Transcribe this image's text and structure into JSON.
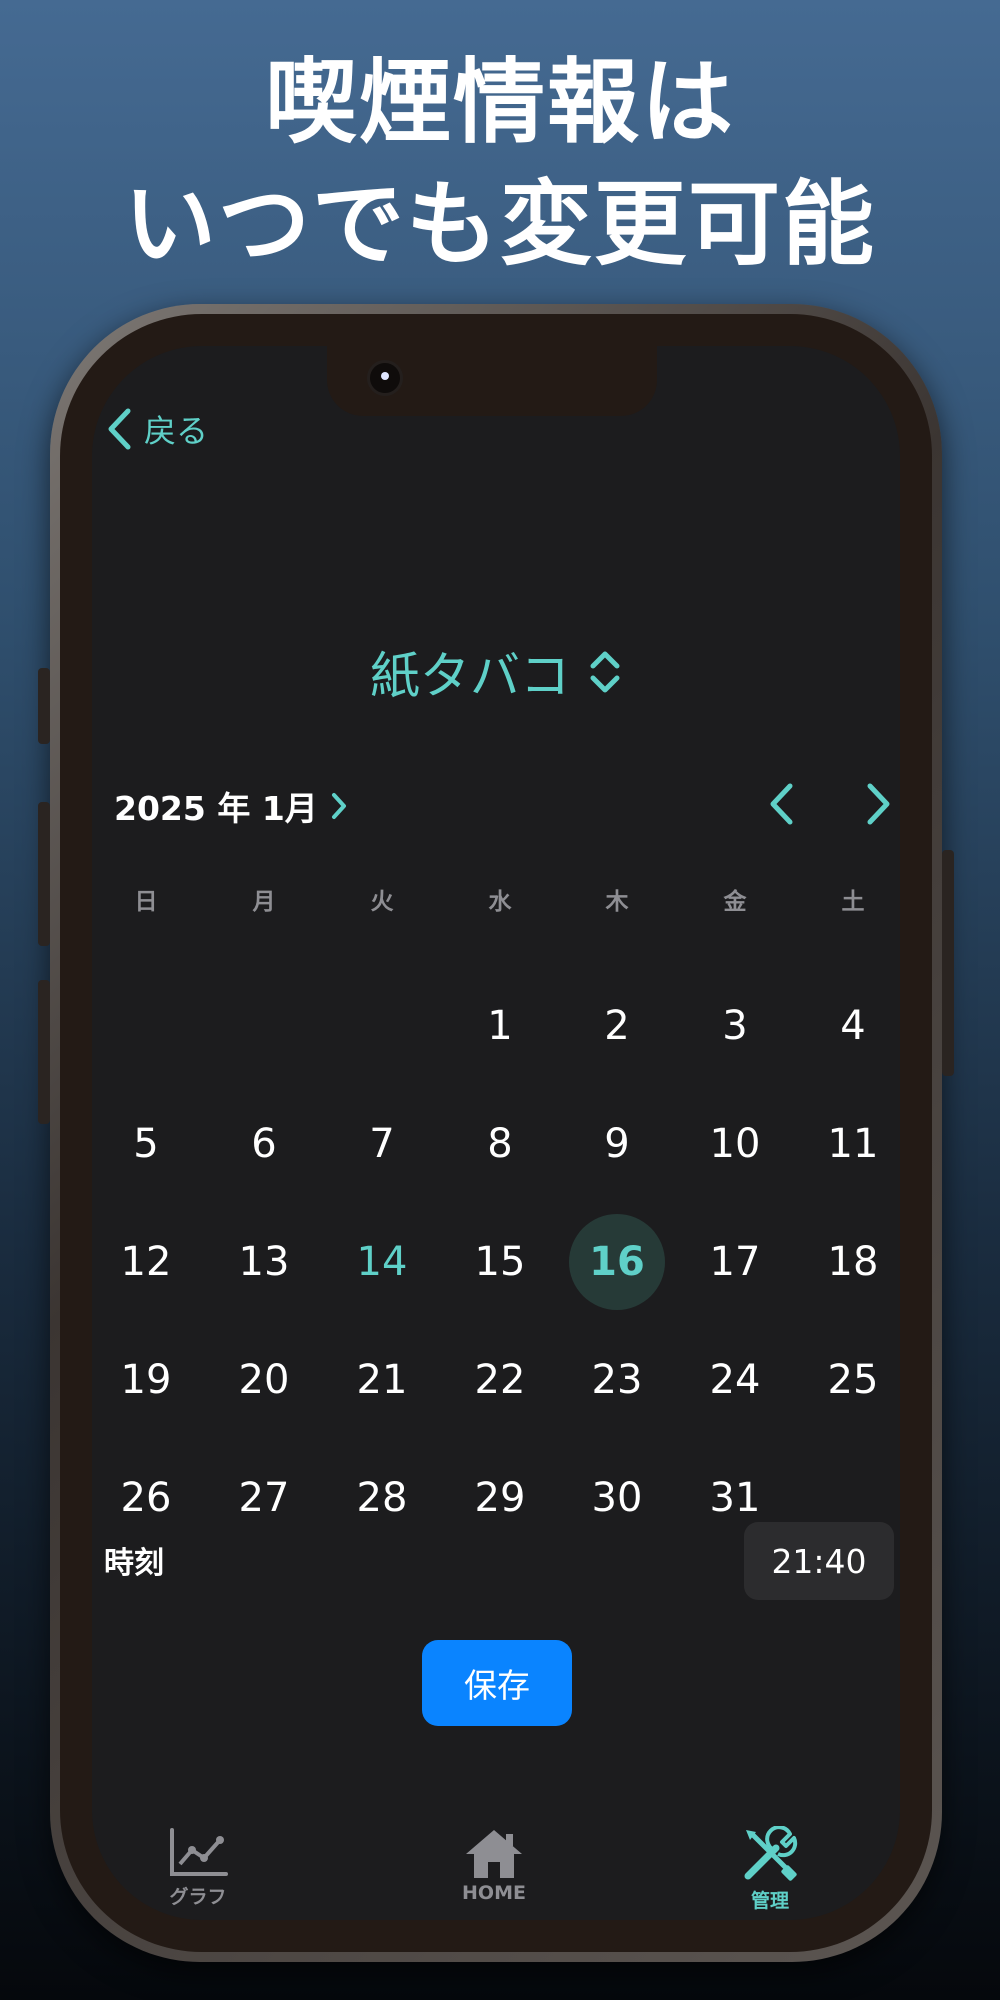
{
  "promo": {
    "line1": "喫煙情報は",
    "line2": "いつでも変更可能"
  },
  "nav": {
    "back_label": "戻る"
  },
  "product": {
    "title": "紙タバコ"
  },
  "calendar": {
    "month_label": "2025 年 1月",
    "weekdays": [
      "日",
      "月",
      "火",
      "水",
      "木",
      "金",
      "土"
    ],
    "first_weekday_index": 3,
    "days": [
      "1",
      "2",
      "3",
      "4",
      "5",
      "6",
      "7",
      "8",
      "9",
      "10",
      "11",
      "12",
      "13",
      "14",
      "15",
      "16",
      "17",
      "18",
      "19",
      "20",
      "21",
      "22",
      "23",
      "24",
      "25",
      "26",
      "27",
      "28",
      "29",
      "30",
      "31"
    ],
    "today": "14",
    "selected": "16"
  },
  "time": {
    "label": "時刻",
    "value": "21:40"
  },
  "actions": {
    "save_label": "保存"
  },
  "tabbar": {
    "graph_label": "グラフ",
    "home_label": "HOME",
    "manage_label": "管理",
    "active": "manage"
  },
  "colors": {
    "accent": "#5fd0c8",
    "save_button": "#0a84ff",
    "screen_bg": "#1c1c1e",
    "inactive_tab": "#8e8e93"
  }
}
